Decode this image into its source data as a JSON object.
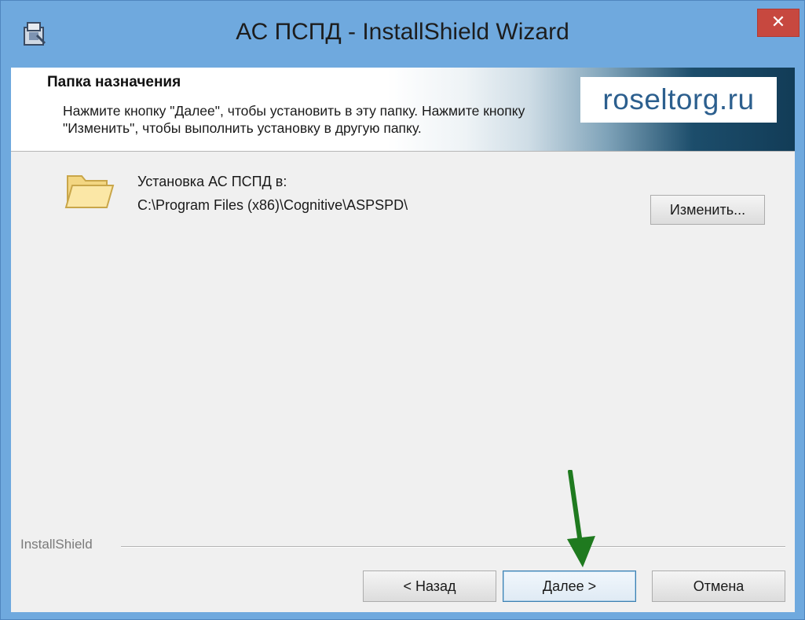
{
  "window": {
    "title": "АС ПСПД - InstallShield Wizard",
    "close_glyph": "✕",
    "titlebar_color": "#6fa9de",
    "close_color": "#c7483f"
  },
  "banner": {
    "title": "Папка назначения",
    "description": "Нажмите кнопку \"Далее\", чтобы установить в эту папку. Нажмите кнопку\n\"Изменить\", чтобы выполнить установку в другую папку.",
    "watermark": "roseltorg.ru"
  },
  "destination": {
    "label": "Установка АС ПСПД в:",
    "path": "C:\\Program Files (x86)\\Cognitive\\ASPSPD\\",
    "change_button": "Изменить..."
  },
  "footer": {
    "brand": "InstallShield",
    "back_button": "< Назад",
    "next_button": "Далее >",
    "cancel_button": "Отмена"
  },
  "icons": {
    "app": "installer-app-icon",
    "folder": "folder-icon",
    "annotation": "green-arrow-icon"
  },
  "colors": {
    "arrow": "#1f7a1f",
    "default_button_border": "#3c7fb1"
  }
}
